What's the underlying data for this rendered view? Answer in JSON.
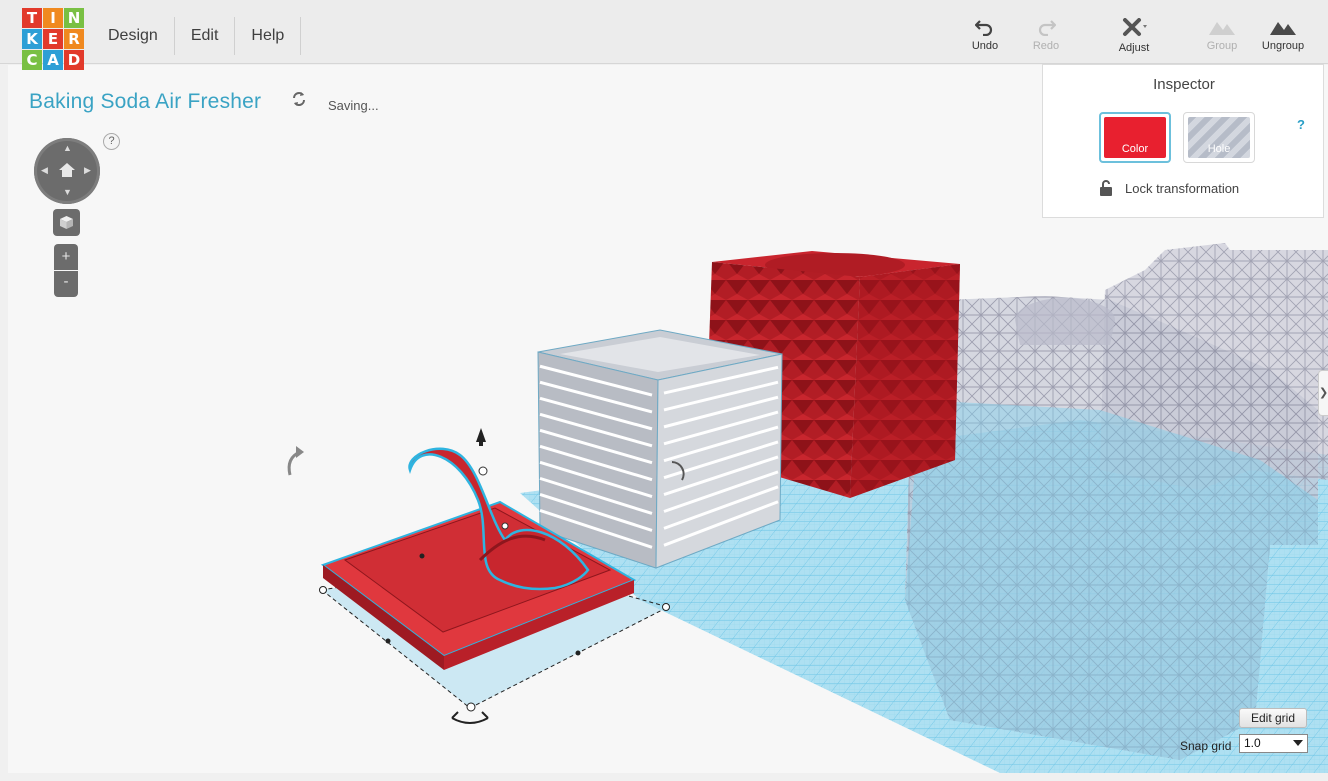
{
  "logo": {
    "letters": [
      "T",
      "I",
      "N",
      "K",
      "E",
      "R",
      "C",
      "A",
      "D"
    ],
    "colors": [
      "#e23a2b",
      "#f0891f",
      "#79c043",
      "#2d9fd6",
      "#e23a2b",
      "#f0891f",
      "#79c043",
      "#2d9fd6",
      "#e23a2b"
    ]
  },
  "menu": {
    "design": "Design",
    "edit": "Edit",
    "help": "Help"
  },
  "toolbar": {
    "undo": "Undo",
    "redo": "Redo",
    "adjust": "Adjust",
    "group": "Group",
    "ungroup": "Ungroup"
  },
  "design": {
    "title": "Baking Soda Air Fresher",
    "status": "Saving..."
  },
  "nav": {
    "help": "?",
    "zoom_in": "+",
    "zoom_out": "-"
  },
  "inspector": {
    "title": "Inspector",
    "color_label": "Color",
    "hole_label": "Hole",
    "help": "?",
    "lock_label": "Lock transformation",
    "selected_color": "#e8202f"
  },
  "grid": {
    "edit_label": "Edit grid",
    "snap_label": "Snap grid",
    "snap_value": "1.0"
  },
  "scene": {
    "objects": [
      "hook-on-base (selected, red)",
      "slatted-box (grey)",
      "patterned-cube (red)",
      "lattice-structure (hole)"
    ]
  },
  "side_tab": {
    "label": "❯"
  }
}
